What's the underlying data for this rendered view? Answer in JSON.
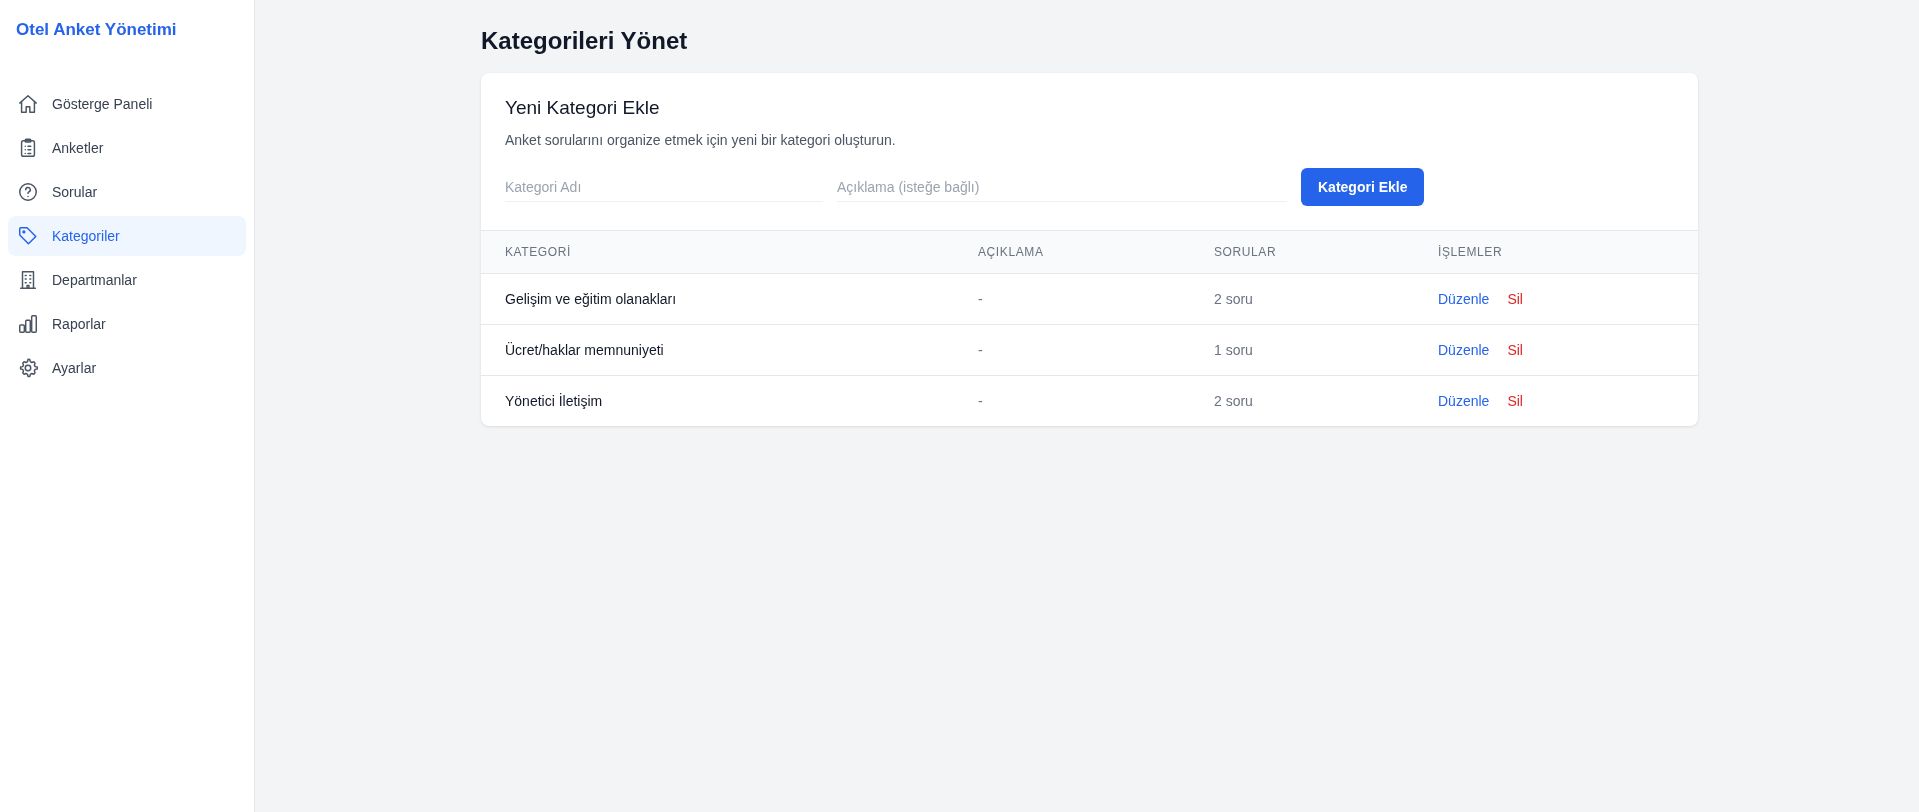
{
  "sidebar": {
    "title": "Otel Anket Yönetimi",
    "items": [
      {
        "label": "Gösterge Paneli",
        "selected": false
      },
      {
        "label": "Anketler",
        "selected": false
      },
      {
        "label": "Sorular",
        "selected": false
      },
      {
        "label": "Kategoriler",
        "selected": true
      },
      {
        "label": "Departmanlar",
        "selected": false
      },
      {
        "label": "Raporlar",
        "selected": false
      },
      {
        "label": "Ayarlar",
        "selected": false
      }
    ]
  },
  "page": {
    "title": "Kategorileri Yönet"
  },
  "form": {
    "title": "Yeni Kategori Ekle",
    "description": "Anket sorularını organize etmek için yeni bir kategori oluşturun.",
    "name_placeholder": "Kategori Adı",
    "description_placeholder": "Açıklama (isteğe bağlı)",
    "button": "Kategori Ekle"
  },
  "table": {
    "columns": [
      "KATEGORİ",
      "AÇIKLAMA",
      "SORULAR",
      "İŞLEMLER"
    ],
    "rows": [
      {
        "name": "Gelişim ve eğitim olanakları",
        "description": "-",
        "questions": "2 soru",
        "edit": "Düzenle",
        "delete": "Sil"
      },
      {
        "name": "Ücret/haklar memnuniyeti",
        "description": "-",
        "questions": "1 soru",
        "edit": "Düzenle",
        "delete": "Sil"
      },
      {
        "name": "Yönetici İletişim",
        "description": "-",
        "questions": "2 soru",
        "edit": "Düzenle",
        "delete": "Sil"
      }
    ]
  }
}
